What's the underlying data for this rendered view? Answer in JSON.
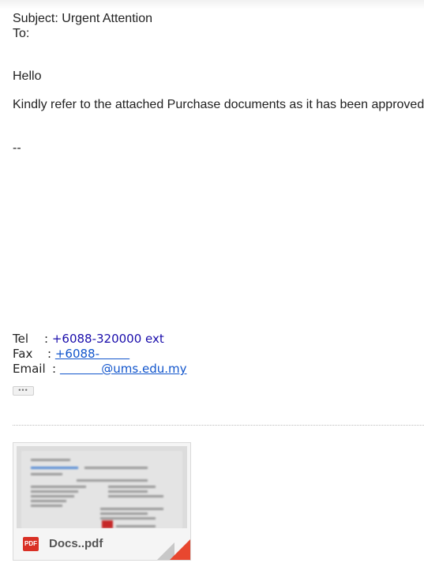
{
  "email": {
    "subject_line": "Subject: Urgent Attention",
    "to_line": "To:",
    "greeting": "Hello",
    "body": "Kindly refer to the attached Purchase documents as it has been approved",
    "sig_separator": "--"
  },
  "signature": {
    "tel_label": "Tel",
    "tel_sep": ":",
    "tel_value": "+6088-320000 ext",
    "fax_label": "Fax",
    "fax_sep": ":",
    "fax_value": "+6088-        ",
    "email_label": "Email",
    "email_sep": ":",
    "email_value": "           @ums.edu.my"
  },
  "trimmed_content_button": "•••",
  "attachment": {
    "file_name": "Docs..pdf",
    "file_type_icon": "pdf-icon",
    "file_type_label": "PDF"
  },
  "colors": {
    "phone_link": "#1a0dab",
    "link": "#1155cc",
    "pdf_red": "#d93025"
  }
}
